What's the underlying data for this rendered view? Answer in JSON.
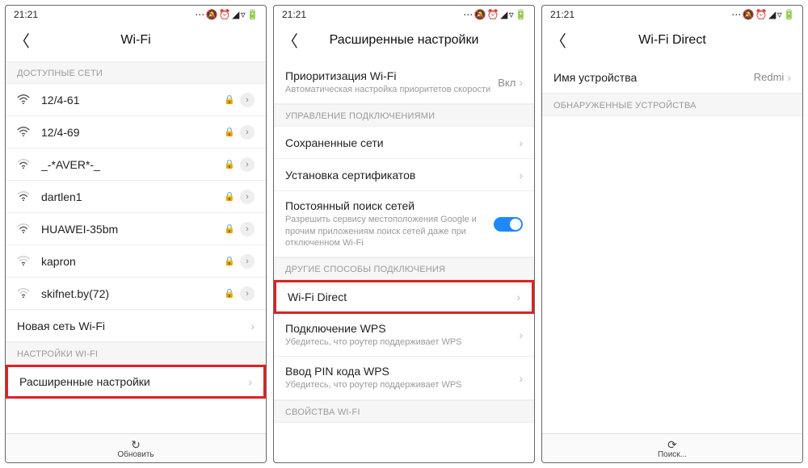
{
  "status": {
    "time": "21:21",
    "icons": "⋯ 🔕 ⏰ ◢ ▿ 🔋"
  },
  "screen1": {
    "title": "Wi-Fi",
    "section_available": "ДОСТУПНЫЕ СЕТИ",
    "networks": [
      {
        "name": "12/4-61"
      },
      {
        "name": "12/4-69"
      },
      {
        "name": "_-*AVER*-_"
      },
      {
        "name": "dartlen1"
      },
      {
        "name": "HUAWEI-35bm"
      },
      {
        "name": "kapron"
      },
      {
        "name": "skifnet.by(72)"
      }
    ],
    "new_network": "Новая сеть Wi-Fi",
    "section_settings": "НАСТРОЙКИ WI-FI",
    "advanced": "Расширенные настройки",
    "refresh": "Обновить"
  },
  "screen2": {
    "title": "Расширенные настройки",
    "priority": {
      "label": "Приоритизация Wi-Fi",
      "sub": "Автоматическая настройка приоритетов скорости",
      "value": "Вкл"
    },
    "section_conn": "УПРАВЛЕНИЕ ПОДКЛЮЧЕНИЯМИ",
    "saved": "Сохраненные сети",
    "certs": "Установка сертификатов",
    "scan": {
      "label": "Постоянный поиск сетей",
      "sub": "Разрешить сервису местоположения Google и прочим приложениям поиск сетей даже при отключенном Wi-Fi"
    },
    "section_other": "ДРУГИЕ СПОСОБЫ ПОДКЛЮЧЕНИЯ",
    "wifi_direct": "Wi-Fi Direct",
    "wps": {
      "label": "Подключение WPS",
      "sub": "Убедитесь, что роутер поддерживает WPS"
    },
    "wps_pin": {
      "label": "Ввод PIN кода WPS",
      "sub": "Убедитесь, что роутер поддерживает WPS"
    },
    "section_props": "СВОЙСТВА WI-FI"
  },
  "screen3": {
    "title": "Wi-Fi Direct",
    "device_name_label": "Имя устройства",
    "device_name_value": "Redmi",
    "section_found": "ОБНАРУЖЕННЫЕ УСТРОЙСТВА",
    "search": "Поиск..."
  }
}
